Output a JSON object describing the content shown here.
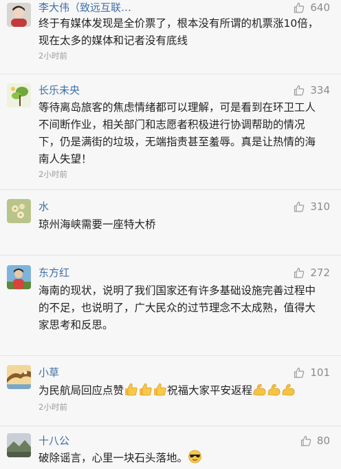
{
  "comments": [
    {
      "author": "李大伟（致远互联…",
      "likes": "640",
      "lines": [
        "终于有媒体发现是全价票了，根本没有所谓的机票涨10倍，",
        "现在太多的媒体和记者没有底线"
      ],
      "time": "2小时前",
      "avatar_icon": "person-avatar-icon"
    },
    {
      "author": "长乐未央",
      "likes": "334",
      "lines": [
        "等待离岛旅客的焦虑情绪都可以理解，可是看到在环卫工人",
        "不间断作业，相关部门和志愿者积极进行协调帮助的情况",
        "下，仍是满街的垃圾，无端指责甚至羞辱。真是让热情的海",
        "南人失望！"
      ],
      "time": "2小时前",
      "avatar_icon": "plant-avatar-icon"
    },
    {
      "author": "水",
      "likes": "310",
      "lines": [
        "琼州海峡需要一座特大桥"
      ],
      "time": "",
      "avatar_icon": "flower-avatar-icon"
    },
    {
      "author": "东方红",
      "likes": "272",
      "lines": [
        "海南的现状，说明了我们国家还有许多基础设施完善过程中",
        "的不足，也说明了，广大民众的过节理念不太成熟，值得大",
        "家思考和反思。"
      ],
      "time": "",
      "avatar_icon": "person-outdoor-avatar-icon"
    },
    {
      "author": "小草",
      "likes": "101",
      "text_before": "为民航局回应点赞",
      "text_middle": "祝福大家平安返程",
      "time": "2小时前",
      "avatar_icon": "eagle-avatar-icon",
      "emoji_thumbs": "thumbs-up-emoji",
      "emoji_strong": "flexed-biceps-emoji"
    },
    {
      "author": "十八公",
      "likes": "80",
      "text": "破除谣言，心里一块石头落地。",
      "avatar_icon": "landscape-avatar-icon",
      "emoji_cool": "sunglasses-face-emoji"
    }
  ],
  "colors": {
    "author": "#3f6fa6",
    "likes": "#8a8a8a",
    "background": "#f7f7f7"
  }
}
